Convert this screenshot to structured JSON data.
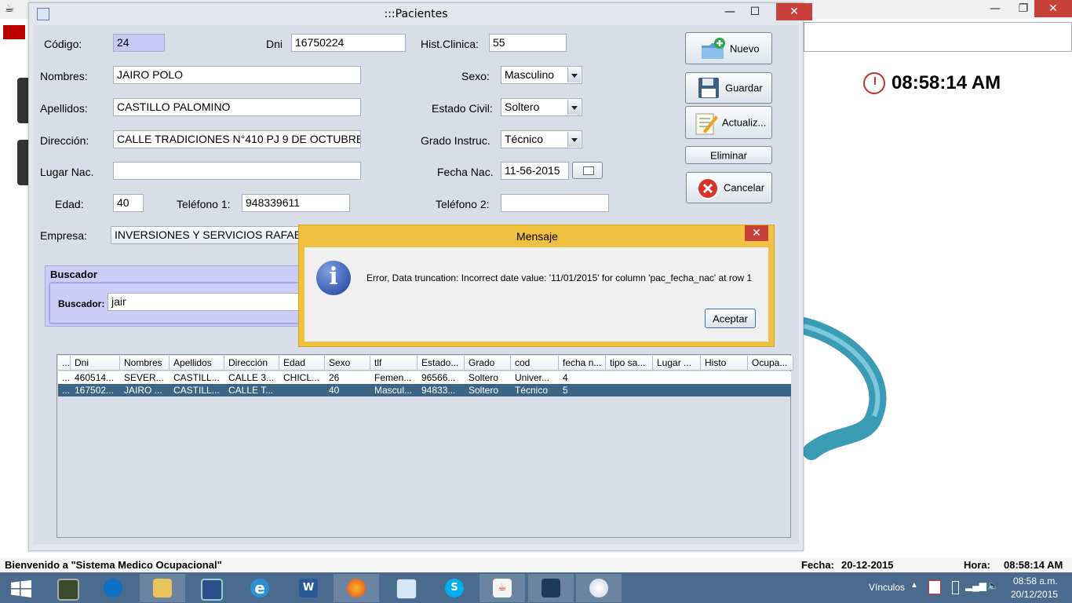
{
  "desktop": {
    "clock": "08:58:14 AM"
  },
  "frame": {
    "title": ":::Pacientes"
  },
  "form": {
    "codigo_label": "Código:",
    "codigo_value": "24",
    "dni_label": "Dni",
    "dni_value": "16750224",
    "hist_label": "Hist.Clinica:",
    "hist_value": "55",
    "nombres_label": "Nombres:",
    "nombres_value": "JAIRO POLO",
    "apellidos_label": "Apellidos:",
    "apellidos_value": "CASTILLO PALOMINO",
    "direccion_label": "Dirección:",
    "direccion_value": "CALLE TRADICIONES N°410 PJ 9 DE OCTUBRE",
    "lugar_label": "Lugar Nac.",
    "lugar_value": "",
    "edad_label": "Edad:",
    "edad_value": "40",
    "tel1_label": "Teléfono 1:",
    "tel1_value": "948339611",
    "empresa_label": "Empresa:",
    "empresa_value": "INVERSIONES Y SERVICIOS RAFAEL S.",
    "sexo_label": "Sexo:",
    "sexo_value": "Masculino",
    "estado_label": "Estado Civil:",
    "estado_value": "Soltero",
    "grado_label": "Grado Instruc.",
    "grado_value": "Técnico",
    "fecha_label": "Fecha Nac.",
    "fecha_value": "11-56-2015",
    "tel2_label": "Teléfono 2:",
    "tel2_value": ""
  },
  "actions": {
    "nuevo": "Nuevo",
    "guardar": "Guardar",
    "actualizar": "Actualiz...",
    "eliminar": "Eliminar",
    "cancelar": "Cancelar"
  },
  "buscador": {
    "title": "Buscador",
    "label": "Buscador:",
    "value": "jair"
  },
  "table": {
    "columns": [
      "...",
      "Dni",
      "Nombres",
      "Apellidos",
      "Dirección",
      "Edad",
      "Sexo",
      "tlf",
      "Estado...",
      "Grado",
      "cod",
      "fecha n...",
      "tipo sa...",
      "Lugar ...",
      "Histo",
      "Ocupa..."
    ],
    "rows": [
      [
        "...",
        "460514...",
        "SEVER...",
        "CASTILL...",
        "CALLE 3...",
        "CHICL...",
        "26",
        "Femen...",
        "96566...",
        "Soltero",
        "Univer...",
        "4",
        "",
        "",
        "",
        ""
      ],
      [
        "...",
        "167502...",
        "JAIRO ...",
        "CASTILL...",
        "CALLE T...",
        "",
        "40",
        "Mascul...",
        "94833...",
        "Soltero",
        "Técnico",
        "5",
        "",
        "",
        "",
        ""
      ]
    ]
  },
  "dialog": {
    "title": "Mensaje",
    "message": "Error, Data truncation: Incorrect date value: '11/01/2015' for column 'pac_fecha_nac' at row 1",
    "ok": "Aceptar"
  },
  "status": {
    "welcome": "Bienvenido  a  \"Sistema Medico Ocupacional\"",
    "fecha_label": "Fecha:",
    "fecha_value": "20-12-2015",
    "hora_label": "Hora:",
    "hora_value": "08:58:14 AM"
  },
  "taskbar": {
    "vinculos": "Vínculos",
    "time": "08:58 a.m.",
    "date": "20/12/2015"
  },
  "colors": {
    "taskbar": "#4a6a8e",
    "selected_row": "#3b6585",
    "dialog_border": "#f0c040",
    "close_red": "#c7413a"
  }
}
